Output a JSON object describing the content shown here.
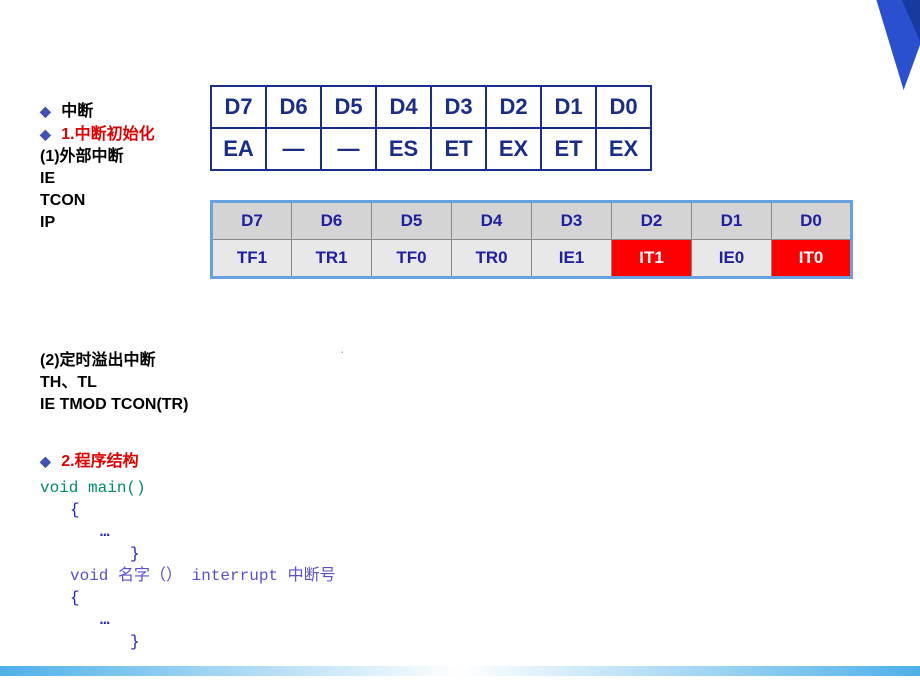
{
  "corner": {},
  "bullets": {
    "b1": "中断",
    "b2_num": "1.",
    "b2_text": "中断初始化",
    "b3_num": "2.",
    "b3_text": "程序结构",
    "diamond": "◆"
  },
  "section1": {
    "sub1": "(1)外部中断",
    "sub1a": "IE",
    "sub1b": "TCON",
    "sub1c": "IP"
  },
  "section2": {
    "sub2": "(2)定时溢出中断",
    "sub2a": "TH、TL",
    "sub2b": "IE   TMOD  TCON(TR)"
  },
  "table1": {
    "r1": [
      "D7",
      "D6",
      "D5",
      "D4",
      "D3",
      "D2",
      "D1",
      "D0"
    ],
    "r2": [
      "EA",
      "—",
      "—",
      "ES",
      "ET",
      "EX",
      "ET",
      "EX"
    ]
  },
  "table2": {
    "r1": [
      "D7",
      "D6",
      "D5",
      "D4",
      "D3",
      "D2",
      "D1",
      "D0"
    ],
    "r2": [
      "TF1",
      "TR1",
      "TF0",
      "TR0",
      "IE1",
      "IT1",
      "IE0",
      "IT0"
    ]
  },
  "dot": "·",
  "code": {
    "l1": "void main()",
    "l2": "{",
    "l3": "…",
    "l4": "}",
    "l5": "void 名字（） interrupt 中断号",
    "l6": "{",
    "l7": "…",
    "l8": "}"
  }
}
